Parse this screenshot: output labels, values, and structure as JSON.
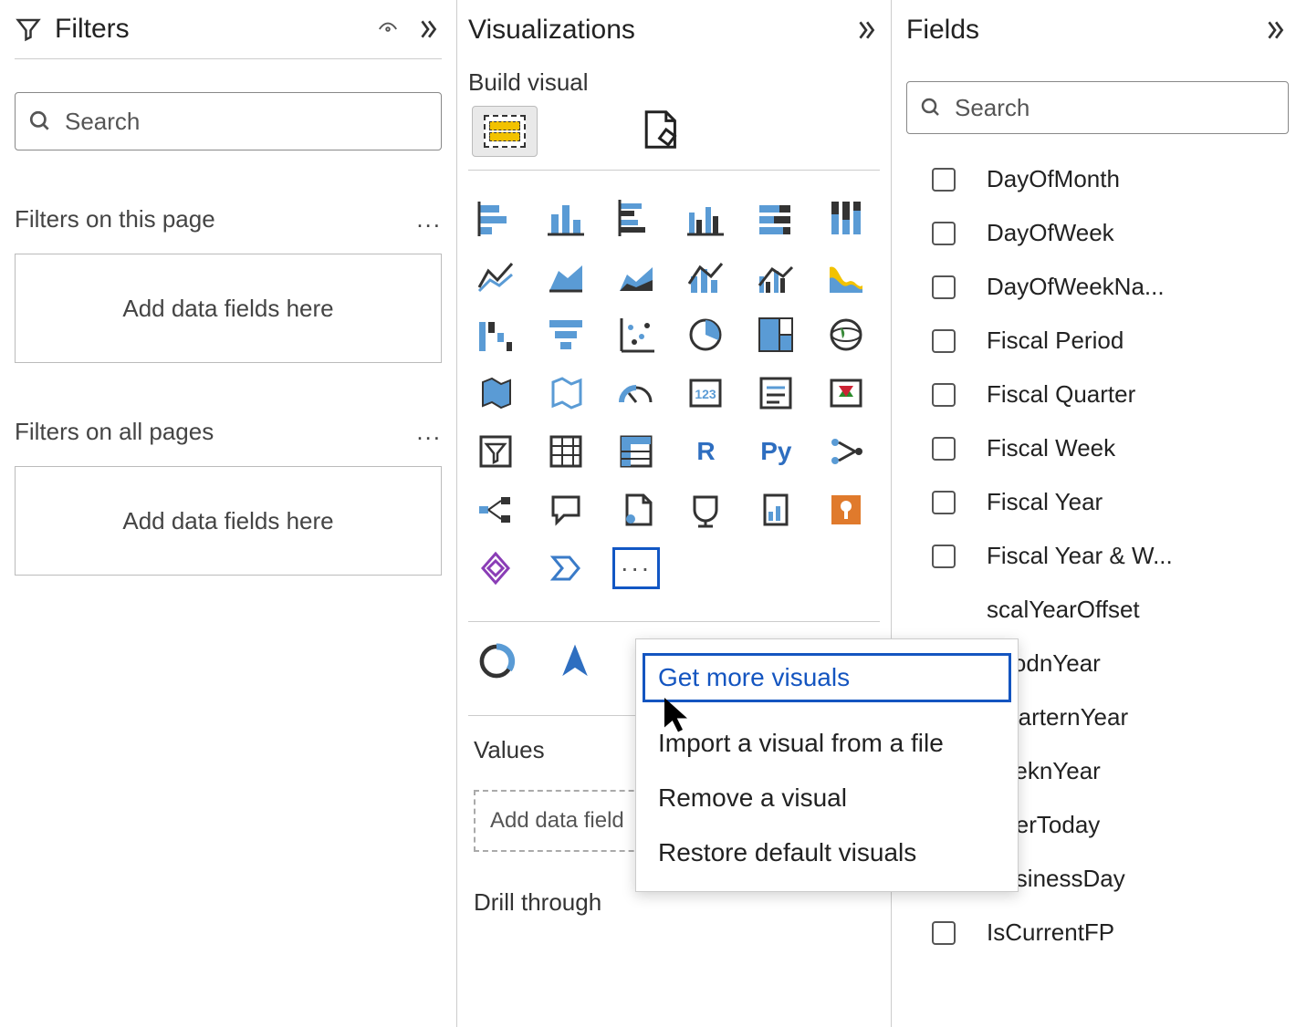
{
  "filters": {
    "title": "Filters",
    "search_placeholder": "Search",
    "section_page": "Filters on this page",
    "section_all": "Filters on all pages",
    "drop_text": "Add data fields here",
    "more_dots": "..."
  },
  "viz": {
    "title": "Visualizations",
    "subtitle": "Build visual",
    "types": {
      "r": "R",
      "py": "Py"
    },
    "more_dots": "···",
    "context_menu": {
      "get_more": "Get more visuals",
      "import": "Import a visual from a file",
      "remove": "Remove a visual",
      "restore": "Restore default visuals"
    },
    "values_label": "Values",
    "values_drop": "Add data field",
    "drill_label": "Drill through"
  },
  "fields": {
    "title": "Fields",
    "search_placeholder": "Search",
    "items": {
      "0": "DayOfMonth",
      "1": "DayOfWeek",
      "2": "DayOfWeekNa...",
      "3": "Fiscal Period",
      "4": "Fiscal Quarter",
      "5": "Fiscal Week",
      "6": "Fiscal Year",
      "7": "Fiscal Year & W...",
      "8": "scalYearOffset",
      "9": "eriodnYear",
      "10": "QuarternYear",
      "11": "VeeknYear",
      "12": "AfterToday",
      "13": "BusinessDay",
      "14": "IsCurrentFP"
    }
  }
}
